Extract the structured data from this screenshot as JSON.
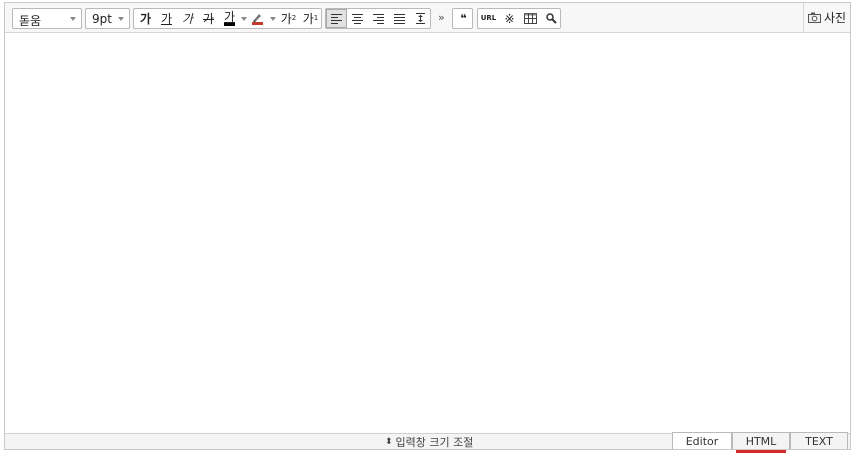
{
  "toolbar": {
    "font_family": "돋움",
    "font_size": "9pt",
    "format_buttons": [
      "가",
      "가",
      "가",
      "가",
      "가"
    ],
    "super_script": "가",
    "sub_script": "가",
    "more": "»",
    "quote": "❝",
    "url": "URL",
    "special_char": "※",
    "photo_label": "사진"
  },
  "bottom": {
    "resize_label": "입력창 크기 조절",
    "resize_icon": "⬍",
    "tabs": [
      {
        "label": "Editor"
      },
      {
        "label": "HTML"
      },
      {
        "label": "TEXT"
      }
    ],
    "active_tab_indicator_color": "#d62a2a"
  },
  "colors": {
    "font_color_bar": "#000000",
    "highlight_color": "#c0392b"
  }
}
